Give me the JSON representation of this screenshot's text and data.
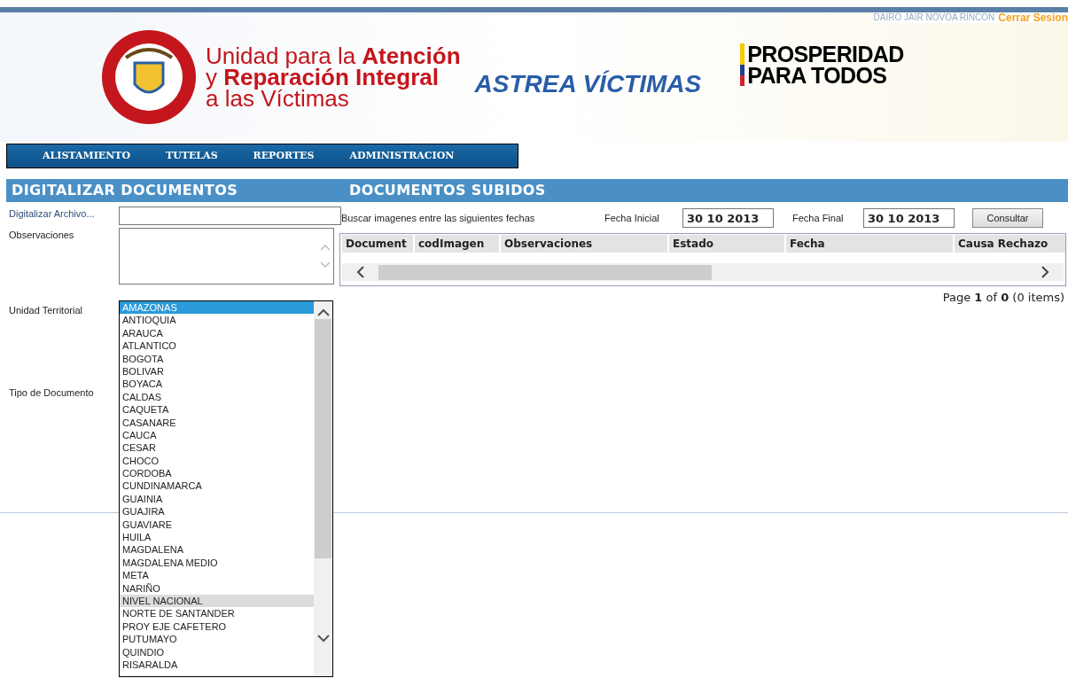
{
  "top_bar": {
    "user": "DAIRO JAIR NOVOA RINCON",
    "logout": "Cerrar Sesion"
  },
  "header": {
    "entity_line1_a": "Unidad para la ",
    "entity_line1_b": "Atención",
    "entity_line2_a": "y ",
    "entity_line2_b": "Reparación Integral",
    "entity_line3": "a las Víctimas",
    "app_name": "ASTREA VÍCTIMAS",
    "slogan_line1": "PROSPERIDAD",
    "slogan_line2": "PARA TODOS"
  },
  "menu": [
    "ALISTAMIENTO",
    "TUTELAS",
    "REPORTES",
    "ADMINISTRACION"
  ],
  "left": {
    "title": "DIGITALIZAR DOCUMENTOS",
    "file_label": "Digitalizar Archivo...",
    "obs_label": "Observaciones",
    "unit_label": "Unidad Territorial",
    "type_label": "Tipo de Documento",
    "units": [
      {
        "label": "AMAZONAS",
        "selected": true,
        "hovered": false
      },
      {
        "label": "ANTIOQUIA",
        "selected": false,
        "hovered": false
      },
      {
        "label": "ARAUCA",
        "selected": false,
        "hovered": false
      },
      {
        "label": "ATLANTICO",
        "selected": false,
        "hovered": false
      },
      {
        "label": "BOGOTA",
        "selected": false,
        "hovered": false
      },
      {
        "label": "BOLIVAR",
        "selected": false,
        "hovered": false
      },
      {
        "label": "BOYACA",
        "selected": false,
        "hovered": false
      },
      {
        "label": "CALDAS",
        "selected": false,
        "hovered": false
      },
      {
        "label": "CAQUETA",
        "selected": false,
        "hovered": false
      },
      {
        "label": "CASANARE",
        "selected": false,
        "hovered": false
      },
      {
        "label": "CAUCA",
        "selected": false,
        "hovered": false
      },
      {
        "label": "CESAR",
        "selected": false,
        "hovered": false
      },
      {
        "label": "CHOCO",
        "selected": false,
        "hovered": false
      },
      {
        "label": "CORDOBA",
        "selected": false,
        "hovered": false
      },
      {
        "label": "CUNDINAMARCA",
        "selected": false,
        "hovered": false
      },
      {
        "label": "GUAINIA",
        "selected": false,
        "hovered": false
      },
      {
        "label": "GUAJIRA",
        "selected": false,
        "hovered": false
      },
      {
        "label": "GUAVIARE",
        "selected": false,
        "hovered": false
      },
      {
        "label": "HUILA",
        "selected": false,
        "hovered": false
      },
      {
        "label": "MAGDALENA",
        "selected": false,
        "hovered": false
      },
      {
        "label": "MAGDALENA MEDIO",
        "selected": false,
        "hovered": false
      },
      {
        "label": "META",
        "selected": false,
        "hovered": false
      },
      {
        "label": "NARIÑO",
        "selected": false,
        "hovered": false
      },
      {
        "label": "NIVEL NACIONAL",
        "selected": false,
        "hovered": true
      },
      {
        "label": "NORTE DE SANTANDER",
        "selected": false,
        "hovered": false
      },
      {
        "label": "PROY EJE CAFETERO",
        "selected": false,
        "hovered": false
      },
      {
        "label": "PUTUMAYO",
        "selected": false,
        "hovered": false
      },
      {
        "label": "QUINDIO",
        "selected": false,
        "hovered": false
      },
      {
        "label": "RISARALDA",
        "selected": false,
        "hovered": false
      }
    ]
  },
  "right": {
    "title": "DOCUMENTOS SUBIDOS",
    "search_label": "Buscar imagenes entre las siguientes fechas",
    "start_label": "Fecha Inicial",
    "start_value": "30 10 2013",
    "end_label": "Fecha Final",
    "end_value": "30 10 2013",
    "button": "Consultar",
    "columns": [
      "Document",
      "codImagen",
      "Observaciones",
      "Estado",
      "Fecha",
      "Causa Rechazo"
    ],
    "pager": "Page **1** of **0** (0 items)"
  }
}
